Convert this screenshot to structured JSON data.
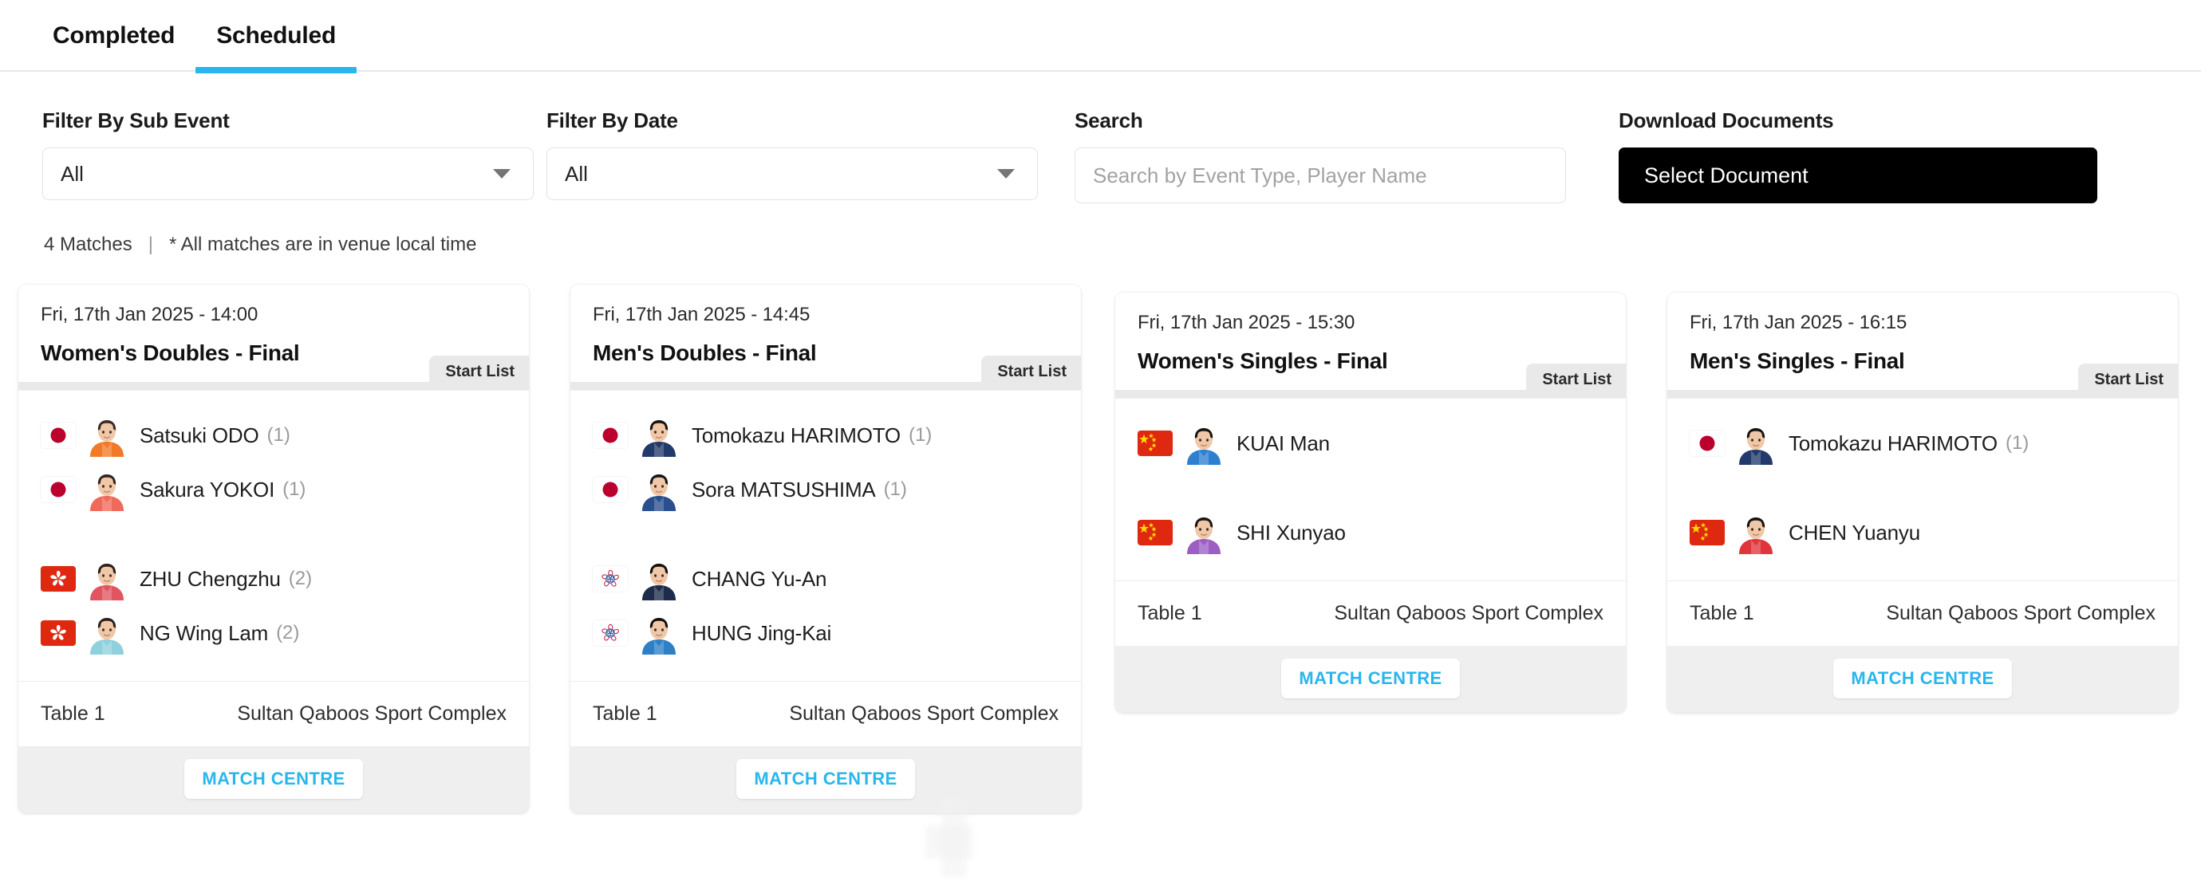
{
  "tabs": [
    {
      "label": "Completed",
      "active": false
    },
    {
      "label": "Scheduled",
      "active": true
    }
  ],
  "filters": {
    "sub_event": {
      "label": "Filter By Sub Event",
      "value": "All"
    },
    "date": {
      "label": "Filter By Date",
      "value": "All"
    },
    "search": {
      "label": "Search",
      "value": "",
      "placeholder": "Search by Event Type, Player Name"
    },
    "documents": {
      "label": "Download Documents",
      "button": "Select Document"
    }
  },
  "meta": {
    "count": "4 Matches",
    "separator": "|",
    "note": "* All matches are in venue local time"
  },
  "labels": {
    "start_list": "Start List",
    "match_centre": "MATCH CENTRE"
  },
  "colors": {
    "accent": "#29b6ed",
    "button_dark": "#000000",
    "card_footer": "#efefef"
  },
  "matches": [
    {
      "date": "Fri, 17th Jan 2025 - 14:00",
      "title": "Women's Doubles - Final",
      "type": "doubles",
      "table": "Table 1",
      "venue": "Sultan Qaboos Sport Complex",
      "teams": [
        [
          {
            "name": "Satsuki ODO",
            "seed": "(1)",
            "flag": "jp",
            "avatar_shirt": "#f07a28",
            "avatar_hair": "#3a2a22"
          },
          {
            "name": "Sakura YOKOI",
            "seed": "(1)",
            "flag": "jp",
            "avatar_shirt": "#ef6a5a",
            "avatar_hair": "#332420"
          }
        ],
        [
          {
            "name": "ZHU Chengzhu",
            "seed": "(2)",
            "flag": "hk",
            "avatar_shirt": "#e0555f",
            "avatar_hair": "#2b201c"
          },
          {
            "name": "NG Wing Lam",
            "seed": "(2)",
            "flag": "hk",
            "avatar_shirt": "#8fd0dd",
            "avatar_hair": "#2b201c"
          }
        ]
      ]
    },
    {
      "date": "Fri, 17th Jan 2025 - 14:45",
      "title": "Men's Doubles - Final",
      "type": "doubles",
      "table": "Table 1",
      "venue": "Sultan Qaboos Sport Complex",
      "teams": [
        [
          {
            "name": "Tomokazu HARIMOTO",
            "seed": "(1)",
            "flag": "jp",
            "avatar_shirt": "#223a6b",
            "avatar_hair": "#171310"
          },
          {
            "name": "Sora MATSUSHIMA",
            "seed": "(1)",
            "flag": "jp",
            "avatar_shirt": "#2a4f8f",
            "avatar_hair": "#171310"
          }
        ],
        [
          {
            "name": "CHANG Yu-An",
            "seed": "",
            "flag": "tw",
            "avatar_shirt": "#1d2c4a",
            "avatar_hair": "#120f0d"
          },
          {
            "name": "HUNG Jing-Kai",
            "seed": "",
            "flag": "tw",
            "avatar_shirt": "#2f7fc4",
            "avatar_hair": "#120f0d"
          }
        ]
      ]
    },
    {
      "date": "Fri, 17th Jan 2025 - 15:30",
      "title": "Women's Singles - Final",
      "type": "singles",
      "table": "Table 1",
      "venue": "Sultan Qaboos Sport Complex",
      "teams": [
        [
          {
            "name": "KUAI Man",
            "seed": "",
            "flag": "cn",
            "avatar_shirt": "#2d7fd0",
            "avatar_hair": "#171310"
          }
        ],
        [
          {
            "name": "SHI Xunyao",
            "seed": "",
            "flag": "cn",
            "avatar_shirt": "#9b5fc4",
            "avatar_hair": "#1d1512"
          }
        ]
      ]
    },
    {
      "date": "Fri, 17th Jan 2025 - 16:15",
      "title": "Men's Singles - Final",
      "type": "singles",
      "table": "Table 1",
      "venue": "Sultan Qaboos Sport Complex",
      "teams": [
        [
          {
            "name": "Tomokazu HARIMOTO",
            "seed": "(1)",
            "flag": "jp",
            "avatar_shirt": "#223a6b",
            "avatar_hair": "#171310"
          }
        ],
        [
          {
            "name": "CHEN Yuanyu",
            "seed": "",
            "flag": "cn",
            "avatar_shirt": "#e0353c",
            "avatar_hair": "#171310"
          }
        ]
      ]
    }
  ]
}
